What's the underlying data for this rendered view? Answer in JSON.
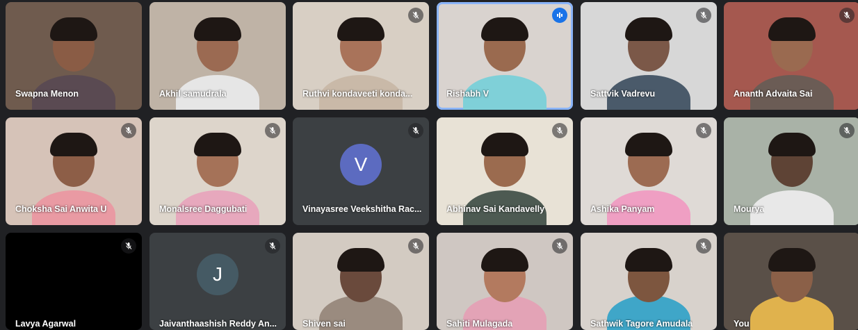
{
  "participants": [
    {
      "name": "Swapna Menon",
      "muted": false,
      "bg": "#6f5b4e",
      "skin": "#8a5c45",
      "shirt": "#5a4a52"
    },
    {
      "name": "Akhil samudrala",
      "muted": false,
      "bg": "#bfb3a6",
      "skin": "#9b6a52",
      "shirt": "#e6e6e6"
    },
    {
      "name": "Ruthvi kondaveeti konda...",
      "muted": true,
      "bg": "#d8cfc4",
      "skin": "#a9735a",
      "shirt": "#c9b9a8"
    },
    {
      "name": "Rishabh V",
      "muted": false,
      "speaking": true,
      "bg": "#d9d3cf",
      "skin": "#9a6a4f",
      "shirt": "#7fd0d8"
    },
    {
      "name": "Sattvik Vadrevu",
      "muted": true,
      "bg": "#d7d7d7",
      "skin": "#7b5848",
      "shirt": "#4a5a6a"
    },
    {
      "name": "Ananth Advaita Sai",
      "muted": true,
      "bg": "#a5584f",
      "skin": "#9a6a50",
      "shirt": "#6b5c55"
    },
    {
      "name": "Choksha Sai Anwita U",
      "muted": true,
      "bg": "#d6c3b8",
      "skin": "#8d5e47",
      "shirt": "#e99aa3"
    },
    {
      "name": "Monalsree Daggubati",
      "muted": true,
      "bg": "#ddd5cb",
      "skin": "#a57258",
      "shirt": "#e7a8bd"
    },
    {
      "name": "Vinayasree Veekshitha Rac...",
      "muted": true,
      "avatar": "V",
      "avatar_color": "#5c6bc0",
      "bg": "#3c4043"
    },
    {
      "name": "Abhinav Sai Kandavelly",
      "muted": true,
      "bg": "#e8e2d6",
      "skin": "#9b6b4f",
      "shirt": "#4d5a52"
    },
    {
      "name": "Ashika Panyam",
      "muted": true,
      "bg": "#dfdad6",
      "skin": "#9c6b52",
      "shirt": "#ef9fc3"
    },
    {
      "name": "Mourya",
      "muted": true,
      "bg": "#a9b2a7",
      "skin": "#5e4335",
      "shirt": "#e8e8e8"
    },
    {
      "name": "Lavya Agarwal",
      "muted": true,
      "bg": "#000000"
    },
    {
      "name": "Jaivanthaashish Reddy An...",
      "muted": true,
      "avatar": "J",
      "avatar_color": "#455a64",
      "bg": "#3c4043"
    },
    {
      "name": "Shiven sai",
      "muted": true,
      "bg": "#d3cbc2",
      "skin": "#6a4a3c",
      "shirt": "#9a8b7f"
    },
    {
      "name": "Sahiti Mulagada",
      "muted": true,
      "bg": "#cfc7c2",
      "skin": "#b37a5f",
      "shirt": "#e3a3b6"
    },
    {
      "name": "Sathwik Tagore Amudala",
      "muted": true,
      "bg": "#d8d2cc",
      "skin": "#7d563f",
      "shirt": "#3fa6c8"
    },
    {
      "name": "You",
      "muted": false,
      "self": true,
      "bg": "#5a5048",
      "skin": "#8b6048",
      "shirt": "#e0b24d"
    }
  ]
}
